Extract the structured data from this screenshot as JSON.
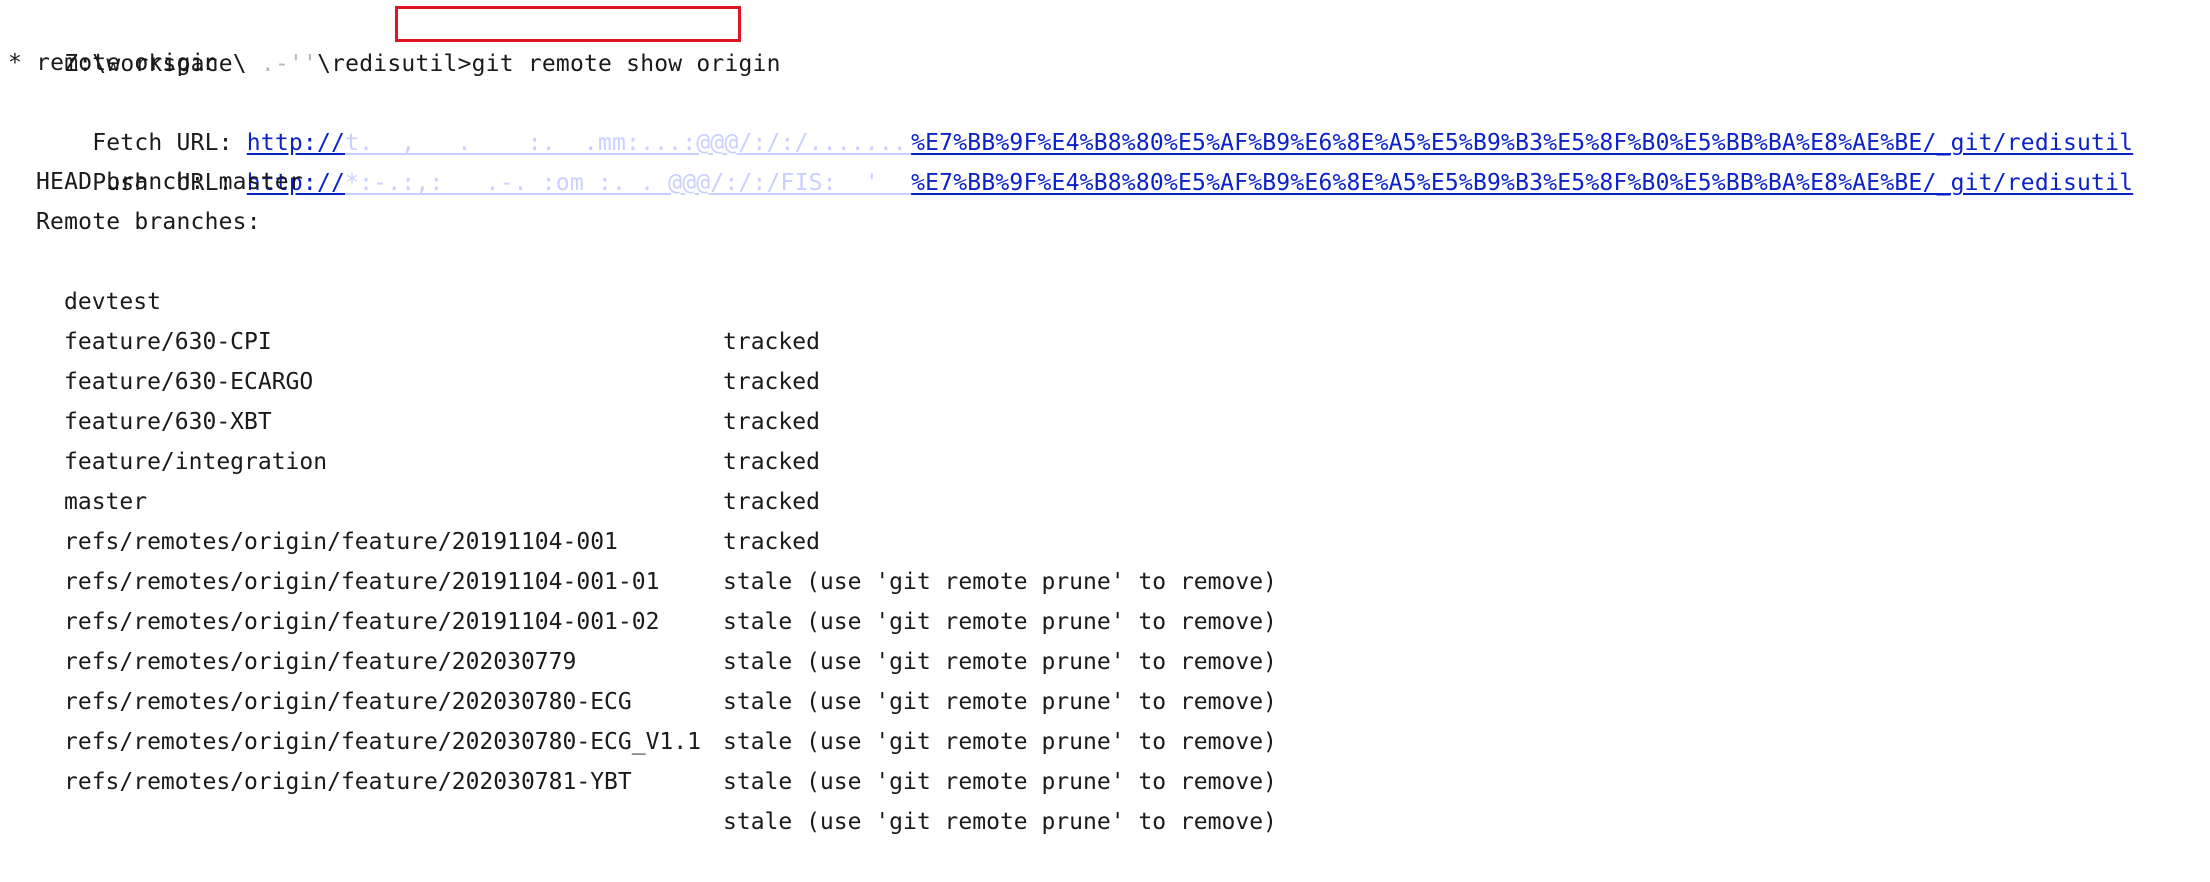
{
  "prompt": {
    "path_prefix": "Z:\\workspace\\",
    "path_masked": " .-''",
    "path_suffix": "\\redisutil",
    "command": "git remote show origin"
  },
  "remote_header": "* remote origin",
  "fetch": {
    "label": "Fetch URL: ",
    "url_prefix": "http://",
    "url_masked": "t.  ,   .    :.  .mm:...:@@@/:/:/.........   ./.:.: ",
    "url_suffix": "%E7%BB%9F%E4%B8%80%E5%AF%B9%E6%8E%A5%E5%B9%B3%E5%8F%B0%E5%BB%BA%E8%AE%BE/_git/redisutil"
  },
  "push": {
    "label": "Push  URL: ",
    "url_prefix": "http://",
    "url_masked": "*:-.:,:   .-. :om :. . @@@/:/:/FIS:  '  .:  :.  -:  ",
    "url_suffix": "%E7%BB%9F%E4%B8%80%E5%AF%B9%E6%8E%A5%E5%B9%B3%E5%8F%B0%E5%BB%BA%E8%AE%BE/_git/redisutil"
  },
  "head_branch": "HEAD branch: master",
  "remote_branches_label": "Remote branches:",
  "branches": [
    {
      "name": "devtest",
      "status": "tracked"
    },
    {
      "name": "feature/630-CPI",
      "status": "tracked"
    },
    {
      "name": "feature/630-ECARGO",
      "status": "tracked"
    },
    {
      "name": "feature/630-XBT",
      "status": "tracked"
    },
    {
      "name": "feature/integration",
      "status": "tracked"
    },
    {
      "name": "master",
      "status": "tracked"
    },
    {
      "name": "refs/remotes/origin/feature/20191104-001",
      "status": "stale (use 'git remote prune' to remove)"
    },
    {
      "name": "refs/remotes/origin/feature/20191104-001-01",
      "status": "stale (use 'git remote prune' to remove)"
    },
    {
      "name": "refs/remotes/origin/feature/20191104-001-02",
      "status": "stale (use 'git remote prune' to remove)"
    },
    {
      "name": "refs/remotes/origin/feature/202030779",
      "status": "stale (use 'git remote prune' to remove)"
    },
    {
      "name": "refs/remotes/origin/feature/202030780-ECG",
      "status": "stale (use 'git remote prune' to remove)"
    },
    {
      "name": "refs/remotes/origin/feature/202030780-ECG_V1.1",
      "status": "stale (use 'git remote prune' to remove)"
    },
    {
      "name": "refs/remotes/origin/feature/202030781-YBT",
      "status": "stale (use 'git remote prune' to remove)"
    }
  ],
  "colors": {
    "link": "#0b22c9",
    "highlight_box": "#e0141e",
    "text": "#1a1a1a",
    "background": "#ffffff"
  }
}
